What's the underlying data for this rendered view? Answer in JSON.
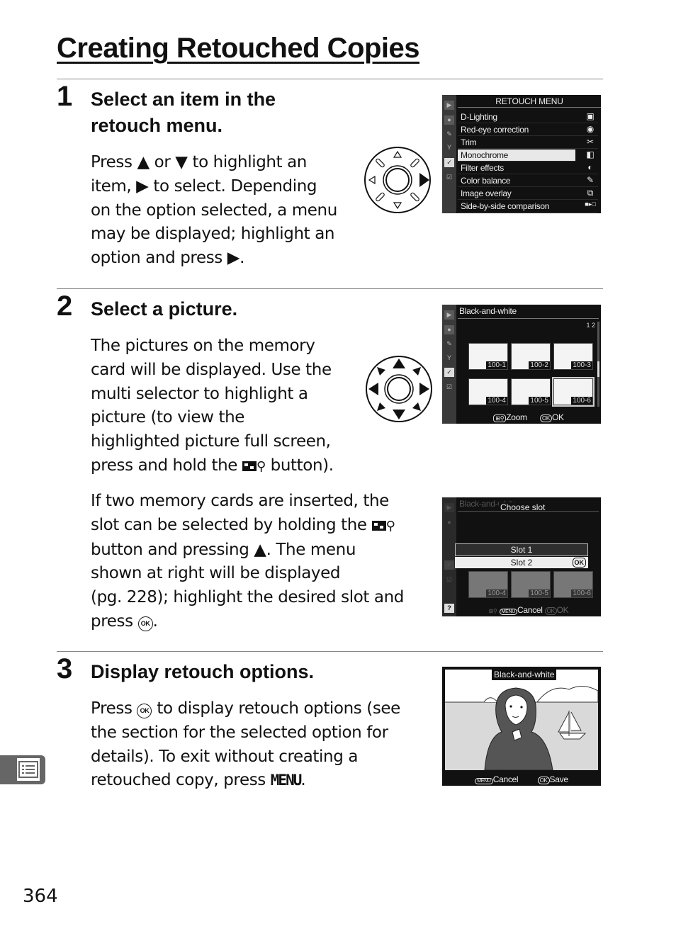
{
  "page": {
    "title": "Creating Retouched Copies",
    "page_number": "364"
  },
  "steps": [
    {
      "number": "1",
      "heading_line1": "Select an item in the",
      "heading_line2": "retouch menu.",
      "body": [
        {
          "type": "text",
          "value": "Press "
        },
        {
          "type": "glyph",
          "value": "▲"
        },
        {
          "type": "text",
          "value": " or "
        },
        {
          "type": "glyph",
          "value": "▼"
        },
        {
          "type": "text",
          "value": " to highlight an"
        }
      ],
      "lines": [
        "Press ▲ or ▼ to highlight an",
        "item, ▶ to select.  Depending",
        "on the option selected, a menu",
        "may be displayed; highlight an",
        "option and press ▶."
      ],
      "selector_icon": "multi-selector-right-icon"
    },
    {
      "number": "2",
      "heading": "Select a picture.",
      "lines": [
        "The pictures on the memory",
        "card will be displayed.  Use the",
        "multi selector to highlight a",
        "picture (to view the",
        "highlighted picture full screen,",
        "press and hold the ",
        " button)."
      ],
      "slot_lines": [
        "If two memory cards are inserted, the",
        "slot can be selected by holding the ",
        "button and pressing ▲.  The menu",
        "shown at right will be displayed",
        "(pg. 228); highlight the desired slot and",
        "press ",
        "."
      ],
      "selector_icon": "multi-selector-all-directions-icon"
    },
    {
      "number": "3",
      "heading": "Display retouch options.",
      "lines": [
        "Press ",
        " to display retouch options (see",
        "the section for the selected option for",
        "details).  To exit without creating a",
        "retouched copy, press ",
        "MENU",
        "."
      ]
    }
  ],
  "glyphs": {
    "up": "▲",
    "down": "▼",
    "right": "▶",
    "ok": "OK",
    "magnifier": "⚲"
  },
  "screens": {
    "retouch_menu": {
      "title": "RETOUCH MENU",
      "sidebar_icons": [
        "playback-icon",
        "camera-icon",
        "pencil-icon",
        "wrench-icon",
        "retouch-icon",
        "my-menu-icon"
      ],
      "items": [
        {
          "label": "D-Lighting",
          "icon": "d-lighting-icon",
          "glyph": "▣"
        },
        {
          "label": "Red-eye correction",
          "icon": "eye-icon",
          "glyph": "◉"
        },
        {
          "label": "Trim",
          "icon": "scissors-icon",
          "glyph": "✂"
        },
        {
          "label": "Monochrome",
          "icon": "monochrome-icon",
          "glyph": "◧",
          "selected": true
        },
        {
          "label": "Filter effects",
          "icon": "filter-icon",
          "glyph": "◐"
        },
        {
          "label": "Color balance",
          "icon": "color-balance-icon",
          "glyph": "✎"
        },
        {
          "label": "Image overlay",
          "icon": "overlay-icon",
          "glyph": "⧉"
        },
        {
          "label": "Side-by-side comparison",
          "icon": "side-by-side-icon",
          "glyph": "■▸□"
        }
      ]
    },
    "picture_select": {
      "title": "Black-and-white",
      "slot_indicator": "1 2",
      "thumbnails": [
        "100-1",
        "100-2",
        "100-3",
        "100-4",
        "100-5",
        "100-6"
      ],
      "selected_thumbnail": "100-6",
      "footer_zoom": "Zoom",
      "footer_ok": "OK"
    },
    "choose_slot": {
      "background_title": "Black-and-white",
      "title": "Choose slot",
      "slots": [
        "Slot 1",
        "Slot 2"
      ],
      "selected_slot": "Slot 2",
      "ok_badge": "OK",
      "help": "?",
      "footer_menu": "MENU",
      "footer_cancel": "Cancel",
      "footer_ok": "OK",
      "thumbnails": [
        "100-4",
        "100-5",
        "100-6"
      ]
    },
    "preview": {
      "title": "Black-and-white",
      "footer_menu": "MENU",
      "footer_cancel": "Cancel",
      "footer_ok": "OK",
      "footer_save": "Save"
    }
  },
  "side_tab": {
    "icon": "menu-list-icon"
  }
}
